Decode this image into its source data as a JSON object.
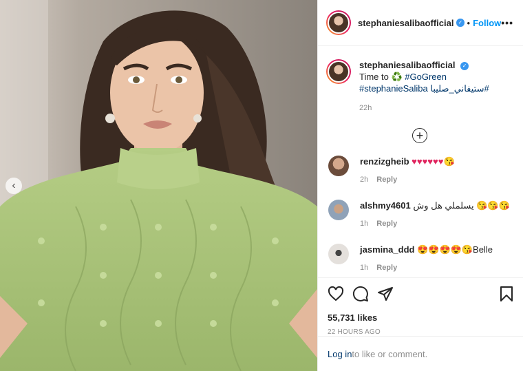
{
  "post": {
    "username": "stephaniesaliba",
    "username_suffix": "official",
    "dot": "•",
    "follow_label": "Follow",
    "more_label": "•••",
    "verified_mark": "✓"
  },
  "caption": {
    "username": "stephaniesalibaofficial",
    "text_prefix": "Time to ♻️ ",
    "hashtag1": "#GoGreen",
    "hashtag2": "#stephanieSaliba",
    "hashtag3": "#ستيفاني_صليبا",
    "time": "22h"
  },
  "load_more_icon": "+",
  "comments": [
    {
      "username": "renzizgheib",
      "text": "♥♥♥♥♥♥😘",
      "time": "2h",
      "reply": "Reply",
      "avatar_color": "#8a6a55"
    },
    {
      "username": "alshmy4601",
      "text": "يسلملي هل وش 😘😘😘",
      "time": "1h",
      "reply": "Reply",
      "avatar_color": "#a8b4c4"
    },
    {
      "username": "jasmina_ddd",
      "text": "😍😍😍😍😘Belle",
      "time": "1h",
      "reply": "Reply",
      "avatar_color": "#d8d4d0"
    }
  ],
  "actions": {
    "icons": [
      "heart-icon",
      "comment-icon",
      "share-icon",
      "bookmark-icon"
    ],
    "likes": "55,731 likes",
    "ago": "22 HOURS AGO"
  },
  "login": {
    "link": "Log in",
    "text": " to like or comment."
  },
  "carousel": {
    "prev_icon": "‹"
  },
  "colors": {
    "accent": "#0095f6",
    "tag": "#00376b",
    "muted": "#8e8e8e",
    "sweater": "#a9c476"
  }
}
